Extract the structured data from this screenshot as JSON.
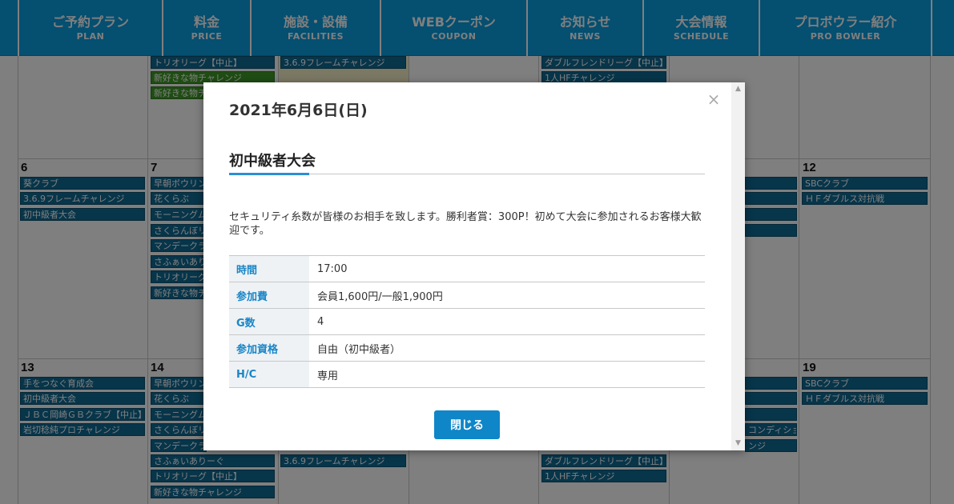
{
  "nav": {
    "items": [
      {
        "ja": "ご予約プラン",
        "en": "PLAN"
      },
      {
        "ja": "料金",
        "en": "PRICE"
      },
      {
        "ja": "施設・設備",
        "en": "FACILITIES"
      },
      {
        "ja": "WEBクーポン",
        "en": "COUPON"
      },
      {
        "ja": "お知らせ",
        "en": "NEWS"
      },
      {
        "ja": "大会情報",
        "en": "SCHEDULE"
      },
      {
        "ja": "プロボウラー紹介",
        "en": "PRO BOWLER"
      }
    ]
  },
  "calendar": {
    "row1": {
      "mon": [
        "トリオリーグ【中止】",
        "新好きな物チャレンジ",
        "新好きな物チャレンジ"
      ],
      "tue": [
        "3.6.9フレームチャレンジ"
      ],
      "fri": [
        "ダブルフレンドリーグ【中止】",
        "1人HFチャレンジ"
      ]
    },
    "row2": {
      "sun_num": "6",
      "mon_num": "7",
      "sat_num": "12",
      "sun": [
        "葵クラブ",
        "3.6.9フレームチャレンジ",
        "初中級者大会"
      ],
      "mon": [
        "早朝ボウリン",
        "花くらぶ",
        "モーニングム",
        "さくらんぼリ",
        "マンデークラ",
        "さふぁいあり",
        "トリオリーグ",
        "新好きな物チ"
      ],
      "sat": [
        "SBCクラブ",
        "ＨＦダブルス対抗戦"
      ]
    },
    "row3": {
      "sun_num": "13",
      "mon_num": "14",
      "sat_num": "19",
      "sun": [
        "手をつなぐ育成会",
        "初中級者大会",
        "ＪＢＣ岡崎ＧＢクラブ【中止】",
        "岩切稔純プロチャレンジ"
      ],
      "mon": [
        "早朝ボウリン",
        "花くらぶ",
        "モーニングム",
        "さくらんぼリ",
        "マンデークラ",
        "さふぁいありーぐ",
        "トリオリーグ【中止】",
        "新好きな物チャレンジ"
      ],
      "tue": [
        "3.6.9フレームチャレンジ"
      ],
      "fri": [
        "ダブルフレンドリーグ【中止】",
        "1人HFチャレンジ"
      ],
      "thu_partial": [
        "コンディショ",
        "ンジ"
      ],
      "sat": [
        "SBCクラブ",
        "ＨＦダブルス対抗戦"
      ]
    }
  },
  "modal": {
    "date": "2021年6月6日(日)",
    "close_icon": "×",
    "title": "初中級者大会",
    "description": "セキュリティ糸数が皆様のお相手を致します。勝利者賞：300P！初めて大会に参加されるお客様大歓迎です。",
    "rows": [
      {
        "key": "時間",
        "value": "17:00"
      },
      {
        "key": "参加費",
        "value": "会員1,600円/一般1,900円"
      },
      {
        "key": "G数",
        "value": "4"
      },
      {
        "key": "参加資格",
        "value": "自由（初中級者）"
      },
      {
        "key": "H/C",
        "value": "専用"
      }
    ],
    "close_button": "閉じる"
  },
  "scrollbar": {
    "up_icon": "▲",
    "down_icon": "▼"
  },
  "colors": {
    "nav": "#0a9ee0",
    "event": "#0f6a94",
    "event_green": "#3f9a27",
    "accent": "#2a8fd4",
    "button": "#0f86c8"
  }
}
